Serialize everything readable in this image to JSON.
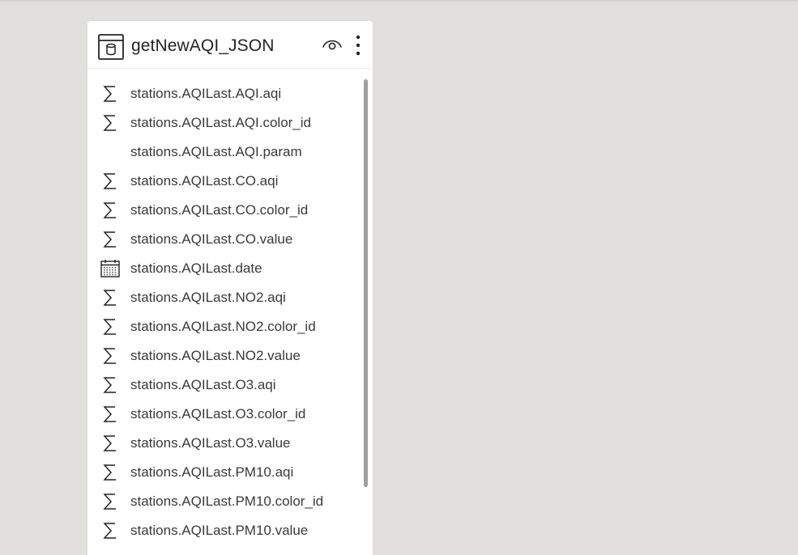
{
  "table": {
    "title": "getNewAQI_JSON",
    "icons": {
      "table": "table-icon",
      "visibility": "eye-icon",
      "more": "more-options-icon"
    }
  },
  "fields": [
    {
      "label": "stations.AQILast.AQI.aqi",
      "icon": "sigma-icon"
    },
    {
      "label": "stations.AQILast.AQI.color_id",
      "icon": "sigma-icon"
    },
    {
      "label": "stations.AQILast.AQI.param",
      "icon": ""
    },
    {
      "label": "stations.AQILast.CO.aqi",
      "icon": "sigma-icon"
    },
    {
      "label": "stations.AQILast.CO.color_id",
      "icon": "sigma-icon"
    },
    {
      "label": "stations.AQILast.CO.value",
      "icon": "sigma-icon"
    },
    {
      "label": "stations.AQILast.date",
      "icon": "calendar-icon"
    },
    {
      "label": "stations.AQILast.NO2.aqi",
      "icon": "sigma-icon"
    },
    {
      "label": "stations.AQILast.NO2.color_id",
      "icon": "sigma-icon"
    },
    {
      "label": "stations.AQILast.NO2.value",
      "icon": "sigma-icon"
    },
    {
      "label": "stations.AQILast.O3.aqi",
      "icon": "sigma-icon"
    },
    {
      "label": "stations.AQILast.O3.color_id",
      "icon": "sigma-icon"
    },
    {
      "label": "stations.AQILast.O3.value",
      "icon": "sigma-icon"
    },
    {
      "label": "stations.AQILast.PM10.aqi",
      "icon": "sigma-icon"
    },
    {
      "label": "stations.AQILast.PM10.color_id",
      "icon": "sigma-icon"
    },
    {
      "label": "stations.AQILast.PM10.value",
      "icon": "sigma-icon"
    }
  ],
  "colors": {
    "canvas": "#e1e0de",
    "card": "#ffffff",
    "text": "#3b3a39",
    "title": "#252423",
    "scrollbar": "#a19f9d"
  }
}
